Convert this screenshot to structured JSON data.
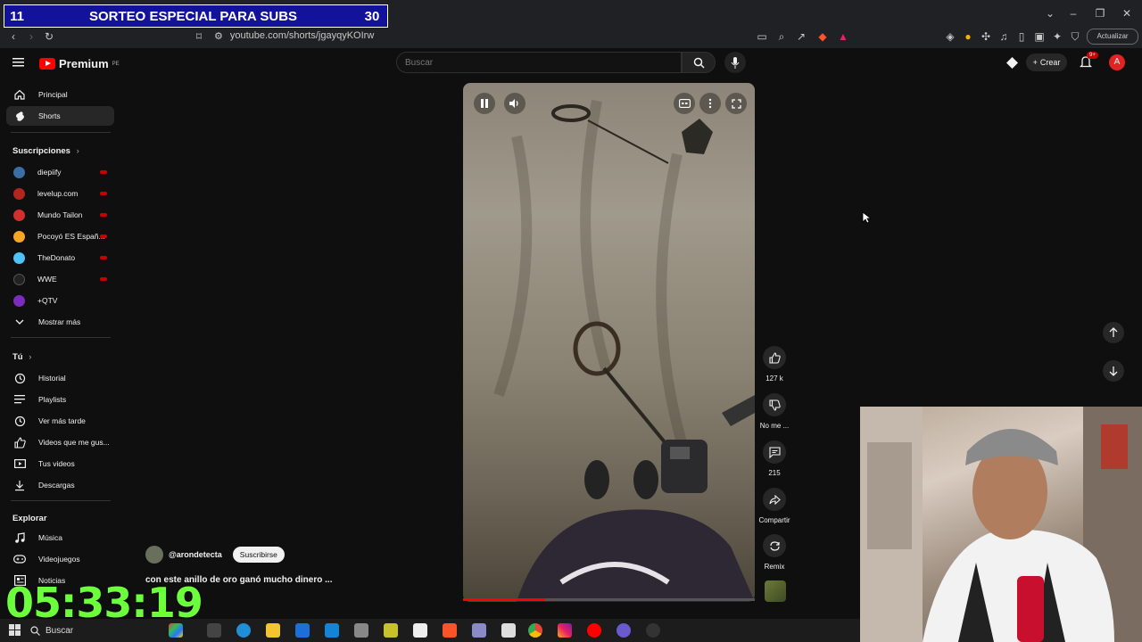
{
  "overlay": {
    "left_number": "11",
    "title": "SORTEO ESPECIAL PARA SUBS",
    "right_number": "30"
  },
  "browser": {
    "url": "youtube.com/shorts/jgayqyKOIrw",
    "update_button": "Actualizar"
  },
  "header": {
    "logo_text": "Premium",
    "logo_region": "PE",
    "search_placeholder": "Buscar",
    "create_label": "Crear",
    "notification_count": "9+",
    "avatar_letter": "A"
  },
  "sidebar": {
    "main": [
      {
        "label": "Principal",
        "icon": "home-icon"
      },
      {
        "label": "Shorts",
        "icon": "shorts-icon"
      }
    ],
    "subscriptions_title": "Suscripciones",
    "channels": [
      {
        "label": "diepiify",
        "color": "#3a6ea5"
      },
      {
        "label": "levelup.com",
        "color": "#b3261e"
      },
      {
        "label": "Mundo Tailon",
        "color": "#d32f2f"
      },
      {
        "label": "Pocoyó ES Españ...",
        "color": "#f5a623"
      },
      {
        "label": "TheDonato",
        "color": "#4fc3f7"
      },
      {
        "label": "WWE",
        "color": "#222222"
      },
      {
        "label": "+QTV",
        "color": "#7b2cbf"
      }
    ],
    "show_more": "Mostrar más",
    "you_title": "Tú",
    "you_items": [
      {
        "label": "Historial",
        "icon": "history-icon"
      },
      {
        "label": "Playlists",
        "icon": "playlist-icon"
      },
      {
        "label": "Ver más tarde",
        "icon": "clock-icon"
      },
      {
        "label": "Videos que me gus...",
        "icon": "thumb-up-icon"
      },
      {
        "label": "Tus videos",
        "icon": "video-icon"
      },
      {
        "label": "Descargas",
        "icon": "download-icon"
      }
    ],
    "explore_title": "Explorar",
    "explore_items": [
      {
        "label": "Música",
        "icon": "music-icon"
      },
      {
        "label": "Videojuegos",
        "icon": "gamepad-icon"
      },
      {
        "label": "Noticias",
        "icon": "news-icon"
      }
    ]
  },
  "video": {
    "channel": "@arondetecta",
    "subscribe_label": "Suscribirse",
    "title": "con este anillo de oro ganó mucho dinero ...",
    "progress_fraction": 0.28
  },
  "actions": {
    "likes": "127 k",
    "dislike": "No me ...",
    "comments": "215",
    "share": "Compartir",
    "remix": "Remix"
  },
  "timer": "05:33:19",
  "taskbar": {
    "search": "Buscar"
  }
}
